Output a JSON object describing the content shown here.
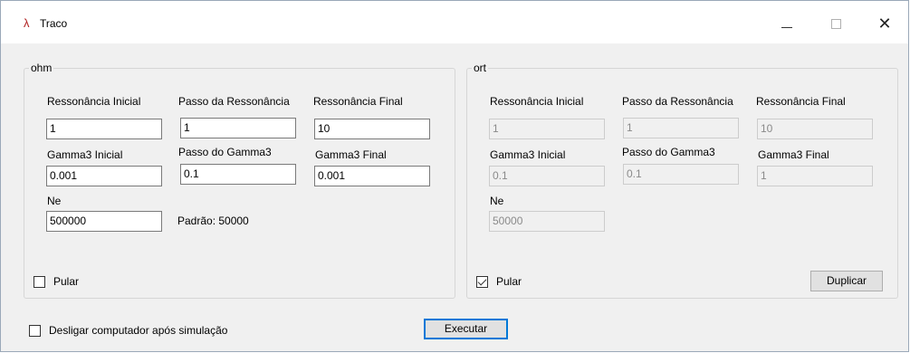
{
  "window": {
    "title": "Traco",
    "app_icon": "lambda-icon"
  },
  "ohm": {
    "legend": "ohm",
    "res_ini_label": "Ressonância Inicial",
    "res_step_label": "Passo da Ressonância",
    "res_end_label": "Ressonância Final",
    "res_ini": "1",
    "res_step": "1",
    "res_end": "10",
    "g3_ini_label": "Gamma3 Inicial",
    "g3_step_label": "Passo do Gamma3",
    "g3_end_label": "Gamma3 Final",
    "g3_ini": "0.001",
    "g3_step": "0.1",
    "g3_end": "0.001",
    "ne_label": "Ne",
    "ne": "500000",
    "default_hint": "Padrão: 50000",
    "skip_label": "Pular",
    "skip_checked": false
  },
  "ort": {
    "legend": "ort",
    "res_ini_label": "Ressonância Inicial",
    "res_step_label": "Passo da Ressonância",
    "res_end_label": "Ressonância Final",
    "res_ini": "1",
    "res_step": "1",
    "res_end": "10",
    "g3_ini_label": "Gamma3 Inicial",
    "g3_step_label": "Passo do Gamma3",
    "g3_end_label": "Gamma3 Final",
    "g3_ini": "0.1",
    "g3_step": "0.1",
    "g3_end": "1",
    "ne_label": "Ne",
    "ne": "50000",
    "skip_label": "Pular",
    "skip_checked": true,
    "duplicate_label": "Duplicar"
  },
  "footer": {
    "shutdown_label": "Desligar computador após simulação",
    "shutdown_checked": false,
    "run_label": "Executar"
  },
  "colors": {
    "accent": "#0078d7",
    "window_bg": "#f0f0f0",
    "icon": "#b02020"
  }
}
